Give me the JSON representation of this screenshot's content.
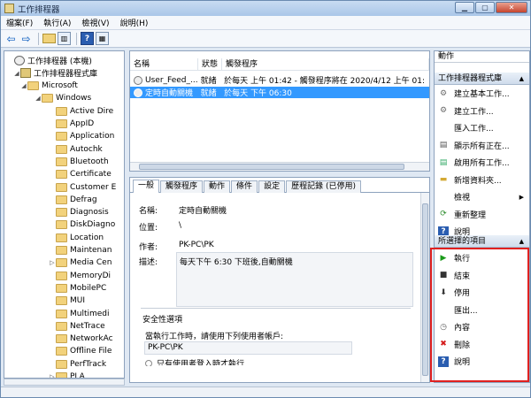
{
  "window": {
    "title": "工作排程器"
  },
  "menu": [
    "檔案(F)",
    "執行(A)",
    "檢視(V)",
    "說明(H)"
  ],
  "tree": [
    {
      "label": "工作排程器 (本機)",
      "level": 0,
      "icon": "clock-icon"
    },
    {
      "label": "工作排程器程式庫",
      "level": 1,
      "icon": "library-icon"
    },
    {
      "label": "Microsoft",
      "level": 2,
      "icon": "folder-icon"
    },
    {
      "label": "Windows",
      "level": 3,
      "icon": "folder-icon"
    },
    {
      "label": "Active Dire",
      "level": 4,
      "icon": "folder-icon"
    },
    {
      "label": "AppID",
      "level": 4,
      "icon": "folder-icon"
    },
    {
      "label": "Application",
      "level": 4,
      "icon": "folder-icon"
    },
    {
      "label": "Autochk",
      "level": 4,
      "icon": "folder-icon"
    },
    {
      "label": "Bluetooth",
      "level": 4,
      "icon": "folder-icon"
    },
    {
      "label": "Certificate",
      "level": 4,
      "icon": "folder-icon"
    },
    {
      "label": "Customer E",
      "level": 4,
      "icon": "folder-icon"
    },
    {
      "label": "Defrag",
      "level": 4,
      "icon": "folder-icon"
    },
    {
      "label": "Diagnosis",
      "level": 4,
      "icon": "folder-icon"
    },
    {
      "label": "DiskDiagno",
      "level": 4,
      "icon": "folder-icon"
    },
    {
      "label": "Location",
      "level": 4,
      "icon": "folder-icon"
    },
    {
      "label": "Maintenan",
      "level": 4,
      "icon": "folder-icon"
    },
    {
      "label": "Media Cen",
      "level": 4,
      "icon": "folder-icon",
      "expandable": true
    },
    {
      "label": "MemoryDi",
      "level": 4,
      "icon": "folder-icon"
    },
    {
      "label": "MobilePC",
      "level": 4,
      "icon": "folder-icon"
    },
    {
      "label": "MUI",
      "level": 4,
      "icon": "folder-icon"
    },
    {
      "label": "Multimedi",
      "level": 4,
      "icon": "folder-icon"
    },
    {
      "label": "NetTrace",
      "level": 4,
      "icon": "folder-icon"
    },
    {
      "label": "NetworkAc",
      "level": 4,
      "icon": "folder-icon"
    },
    {
      "label": "Offline File",
      "level": 4,
      "icon": "folder-icon"
    },
    {
      "label": "PerfTrack",
      "level": 4,
      "icon": "folder-icon"
    },
    {
      "label": "PLA",
      "level": 4,
      "icon": "folder-icon",
      "expandable": true
    }
  ],
  "task_list": {
    "columns": [
      "名稱",
      "狀態",
      "觸發程序"
    ],
    "rows": [
      {
        "name": "User_Feed_...",
        "status": "就緒",
        "trigger": "於每天 上午 01:42 - 觸發程序將在 2020/4/12 上午 01:",
        "selected": false
      },
      {
        "name": "定時自動關機",
        "status": "就緒",
        "trigger": "於每天 下午 06:30",
        "selected": true
      }
    ]
  },
  "details": {
    "tabs": [
      "一般",
      "觸發程序",
      "動作",
      "條件",
      "設定",
      "歷程記錄 (已停用)"
    ],
    "name_label": "名稱:",
    "name_value": "定時自動關機",
    "location_label": "位置:",
    "location_value": "\\",
    "author_label": "作者:",
    "author_value": "PK-PC\\PK",
    "description_label": "描述:",
    "description_value": "每天下午 6:30 下班後,自動關機",
    "security_title": "安全性選項",
    "security_text": "當執行工作時，請使用下列使用者帳戶:",
    "security_user": "PK-PC\\PK",
    "security_option": "只有使用者登入時才執行"
  },
  "actions": {
    "title": "動作",
    "section1": "工作排程器程式庫",
    "items1": [
      {
        "label": "建立基本工作...",
        "icon": "create-basic-task-icon"
      },
      {
        "label": "建立工作...",
        "icon": "create-task-icon"
      },
      {
        "label": "匯入工作...",
        "icon": ""
      },
      {
        "label": "顯示所有正在...",
        "icon": "running-tasks-icon"
      },
      {
        "label": "啟用所有工作...",
        "icon": "history-icon"
      },
      {
        "label": "新增資料夾...",
        "icon": "new-folder-icon"
      },
      {
        "label": "檢視",
        "icon": "",
        "submenu": true
      },
      {
        "label": "重新整理",
        "icon": "refresh-icon"
      },
      {
        "label": "說明",
        "icon": "help-icon"
      }
    ],
    "section2": "所選擇的項目",
    "items2": [
      {
        "label": "執行",
        "icon": "run-icon"
      },
      {
        "label": "結束",
        "icon": "stop-icon"
      },
      {
        "label": "停用",
        "icon": "disable-icon"
      },
      {
        "label": "匯出...",
        "icon": ""
      },
      {
        "label": "內容",
        "icon": "properties-icon"
      },
      {
        "label": "刪除",
        "icon": "delete-icon"
      },
      {
        "label": "說明",
        "icon": "help-icon"
      }
    ]
  }
}
